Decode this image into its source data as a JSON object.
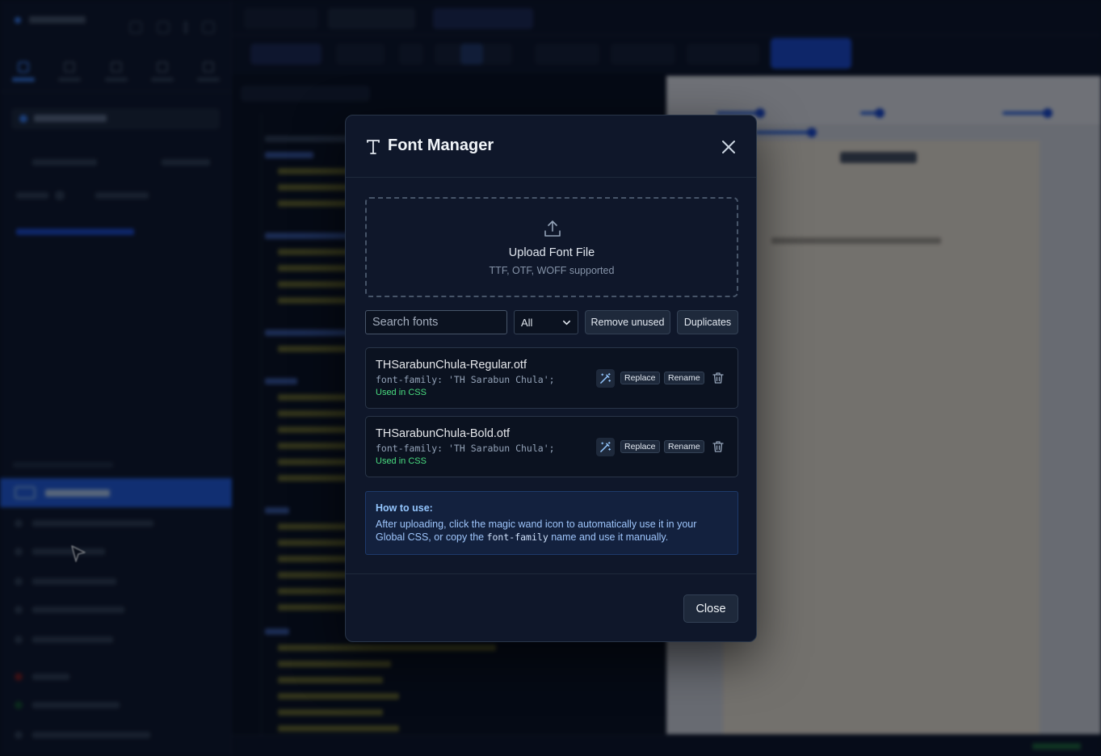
{
  "modal": {
    "title": "Font Manager",
    "upload": {
      "title": "Upload Font File",
      "subtitle": "TTF, OTF, WOFF supported"
    },
    "filters": {
      "search_placeholder": "Search fonts",
      "select_value": "All",
      "remove_unused_label": "Remove unused",
      "duplicates_label": "Duplicates"
    },
    "fonts": [
      {
        "file": "THSarabunChula-Regular.otf",
        "family": "font-family: 'TH Sarabun Chula';",
        "status": "Used in CSS",
        "replace_label": "Replace",
        "rename_label": "Rename"
      },
      {
        "file": "THSarabunChula-Bold.otf",
        "family": "font-family: 'TH Sarabun Chula';",
        "status": "Used in CSS",
        "replace_label": "Replace",
        "rename_label": "Rename"
      }
    ],
    "info": {
      "title": "How to use:",
      "body_before": "After uploading, click the magic wand icon to automatically use it in your Global CSS, or copy the ",
      "body_code": "font-family",
      "body_after": " name and use it manually."
    },
    "close_label": "Close"
  },
  "icons": {
    "title": "text-font-icon",
    "close": "close-icon",
    "upload": "upload-icon",
    "wand": "magic-wand-icon",
    "trash": "trash-icon",
    "chevron": "chevron-down-icon"
  },
  "colors": {
    "accent": "#2563eb",
    "used_status": "#4ade80",
    "info_text": "#9ec5fb",
    "modal_bg": "#0f172a"
  }
}
